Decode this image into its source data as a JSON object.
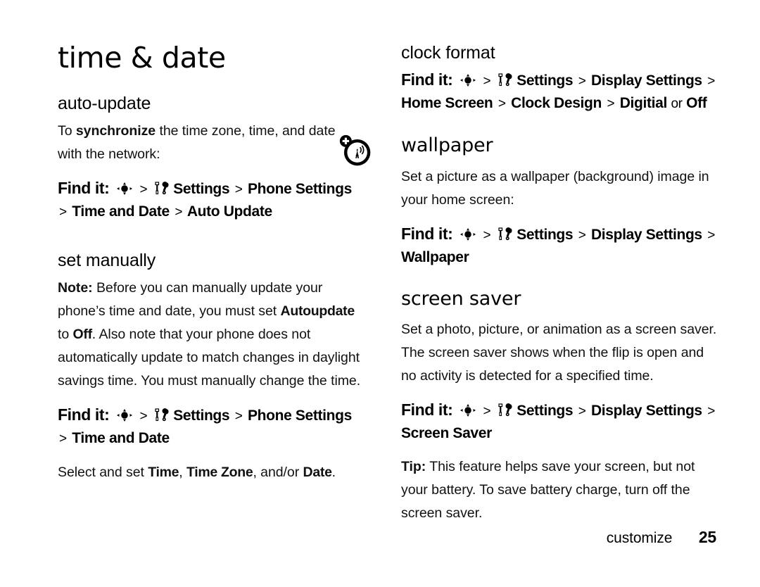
{
  "page": {
    "chapter_title": "time & date",
    "footer_label": "customize",
    "footer_page_number": "25"
  },
  "icons": {
    "nav_key": "five-way-navigation-key-icon",
    "settings_tools": "screwdriver-wrench-settings-icon",
    "margin_alert": "auto-network-update-icon"
  },
  "left_column": {
    "sections": [
      {
        "heading": "auto-update",
        "paragraph_prefix": "To ",
        "paragraph_bold": "synchronize",
        "paragraph_suffix": " the time zone, time, and date with the network:",
        "find_it": {
          "label": "Find it:",
          "steps": [
            "Settings",
            "Phone Settings",
            "Time and Date",
            "Auto Update"
          ],
          "separator": ">"
        }
      },
      {
        "heading": "set manually",
        "note_label": "Note:",
        "note_part1": " Before you can manually update your phone’s time and date, you must set ",
        "note_menu1": "Autoupdate",
        "note_part2": " to ",
        "note_menu2": "Off",
        "note_part3": ". Also note that your phone does not automatically update to match changes in daylight savings time. You must manually change the time.",
        "find_it": {
          "label": "Find it:",
          "steps": [
            "Settings",
            "Phone Settings",
            "Time and Date"
          ],
          "separator": ">"
        },
        "select_prefix": "Select and set ",
        "select_item1": "Time",
        "select_join1": ", ",
        "select_item2": "Time Zone",
        "select_join2": ", and/or ",
        "select_item3": "Date",
        "select_suffix": "."
      }
    ]
  },
  "right_column": {
    "sections": [
      {
        "heading": "clock format",
        "find_it": {
          "label": "Find it:",
          "steps": [
            "Settings",
            "Display Settings",
            "Home Screen",
            "Clock Design",
            "Digitial"
          ],
          "separator": ">",
          "tail_join": "or",
          "tail_option": "Off"
        }
      },
      {
        "heading": "wallpaper",
        "paragraph": "Set a picture as a wallpaper (background) image in your home screen:",
        "find_it": {
          "label": "Find it:",
          "steps": [
            "Settings",
            "Display Settings",
            "Wallpaper"
          ],
          "separator": ">"
        }
      },
      {
        "heading": "screen saver",
        "paragraph": "Set a photo, picture, or animation as a screen saver. The screen saver shows when the flip is open and no activity is detected for a specified time.",
        "find_it": {
          "label": "Find it:",
          "steps": [
            "Settings",
            "Display Settings",
            "Screen Saver"
          ],
          "separator": ">"
        },
        "tip_label": "Tip:",
        "tip_text": " This feature helps save your screen, but not your battery. To save battery charge, turn off the screen saver."
      }
    ]
  }
}
